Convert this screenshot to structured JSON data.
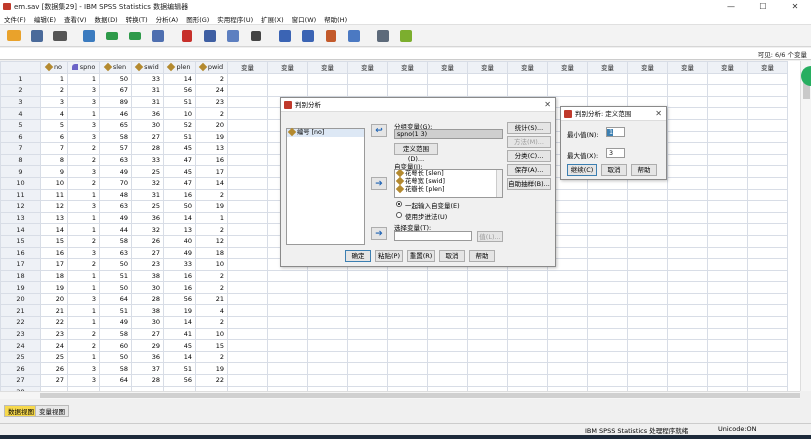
{
  "window": {
    "title": "em.sav [数据集29] - IBM SPSS Statistics 数据编辑器",
    "min_glyph": "—",
    "max_glyph": "☐",
    "close_glyph": "✕"
  },
  "menu": [
    "文件(F)",
    "编辑(E)",
    "查看(V)",
    "数据(D)",
    "转换(T)",
    "分析(A)",
    "图形(G)",
    "实用程序(U)",
    "扩展(X)",
    "窗口(W)",
    "帮助(H)"
  ],
  "toolbar_icons": [
    "open-file-icon",
    "save-icon",
    "print-icon",
    "dialog-recall-icon",
    "undo-icon",
    "redo-icon",
    "goto-case-icon",
    "goto-variable-icon",
    "variables-icon",
    "run-descriptive-icon",
    "find-icon",
    "insert-cases-icon",
    "insert-variable-icon",
    "split-file-icon",
    "weight-cases-icon",
    "select-cases-icon",
    "value-labels-icon"
  ],
  "visible_label": "可见: 6/6 个变量",
  "columns": [
    "no",
    "spno",
    "slen",
    "swid",
    "plen",
    "pwid"
  ],
  "empty_col_label": "变量",
  "rows": [
    [
      1,
      1,
      50,
      33,
      14,
      2
    ],
    [
      2,
      3,
      67,
      31,
      56,
      24
    ],
    [
      3,
      3,
      89,
      31,
      51,
      23
    ],
    [
      4,
      1,
      46,
      36,
      10,
      2
    ],
    [
      5,
      3,
      65,
      30,
      52,
      20
    ],
    [
      6,
      3,
      58,
      27,
      51,
      19
    ],
    [
      7,
      2,
      57,
      28,
      45,
      13
    ],
    [
      8,
      2,
      63,
      33,
      47,
      16
    ],
    [
      9,
      3,
      49,
      25,
      45,
      17
    ],
    [
      10,
      2,
      70,
      32,
      47,
      14
    ],
    [
      11,
      1,
      48,
      31,
      16,
      2
    ],
    [
      12,
      3,
      63,
      25,
      50,
      19
    ],
    [
      13,
      1,
      49,
      36,
      14,
      1
    ],
    [
      14,
      1,
      44,
      32,
      13,
      2
    ],
    [
      15,
      2,
      58,
      26,
      40,
      12
    ],
    [
      16,
      3,
      63,
      27,
      49,
      18
    ],
    [
      17,
      2,
      50,
      23,
      33,
      10
    ],
    [
      18,
      1,
      51,
      38,
      16,
      2
    ],
    [
      19,
      1,
      50,
      30,
      16,
      2
    ],
    [
      20,
      3,
      64,
      28,
      56,
      21
    ],
    [
      21,
      1,
      51,
      38,
      19,
      4
    ],
    [
      22,
      1,
      49,
      30,
      14,
      2
    ],
    [
      23,
      2,
      58,
      27,
      41,
      10
    ],
    [
      24,
      2,
      60,
      29,
      45,
      15
    ],
    [
      25,
      1,
      50,
      36,
      14,
      2
    ],
    [
      26,
      3,
      58,
      37,
      51,
      19
    ],
    [
      27,
      3,
      64,
      28,
      56,
      22
    ]
  ],
  "partial_row": [
    "28",
    "",
    "",
    "",
    "",
    ""
  ],
  "tabs": {
    "data_view": "数据视图",
    "variable_view": "变量视图"
  },
  "status": {
    "processor": "IBM SPSS Statistics 处理程序就绪",
    "unicode": "Unicode:ON"
  },
  "discriminant_dialog": {
    "title": "判别分析",
    "source_list": [
      "编号 [no]"
    ],
    "grouping_label": "分组变量(G):",
    "grouping_value": "spno(1 3)",
    "define_range_btn": "定义范围(D)...",
    "independents_label": "自变量(I):",
    "independents": [
      "花萼长 [slen]",
      "花萼宽 [swid]",
      "花瓣长 [plen]"
    ],
    "method_enter": "一起输入自变量(E)",
    "method_stepwise": "使用步进法(U)",
    "selection_label": "选择变量(T):",
    "value_btn": "值(L)...",
    "side_buttons": [
      "统计(S)...",
      "方法(M)...",
      "分类(C)...",
      "保存(A)...",
      "自助抽样(B)..."
    ],
    "bottom_buttons": [
      "确定",
      "粘贴(P)",
      "重置(R)",
      "取消",
      "帮助"
    ]
  },
  "range_dialog": {
    "title": "判别分析: 定义范围",
    "min_label": "最小值(N):",
    "min_value": "1",
    "max_label": "最大值(X):",
    "max_value": "3",
    "continue_btn": "继续(C)",
    "cancel_btn": "取消",
    "help_btn": "帮助"
  },
  "colors": {
    "accent": "#1e63b4",
    "tab_active": "#f7d94c",
    "grid_header": "#eef1f6"
  }
}
